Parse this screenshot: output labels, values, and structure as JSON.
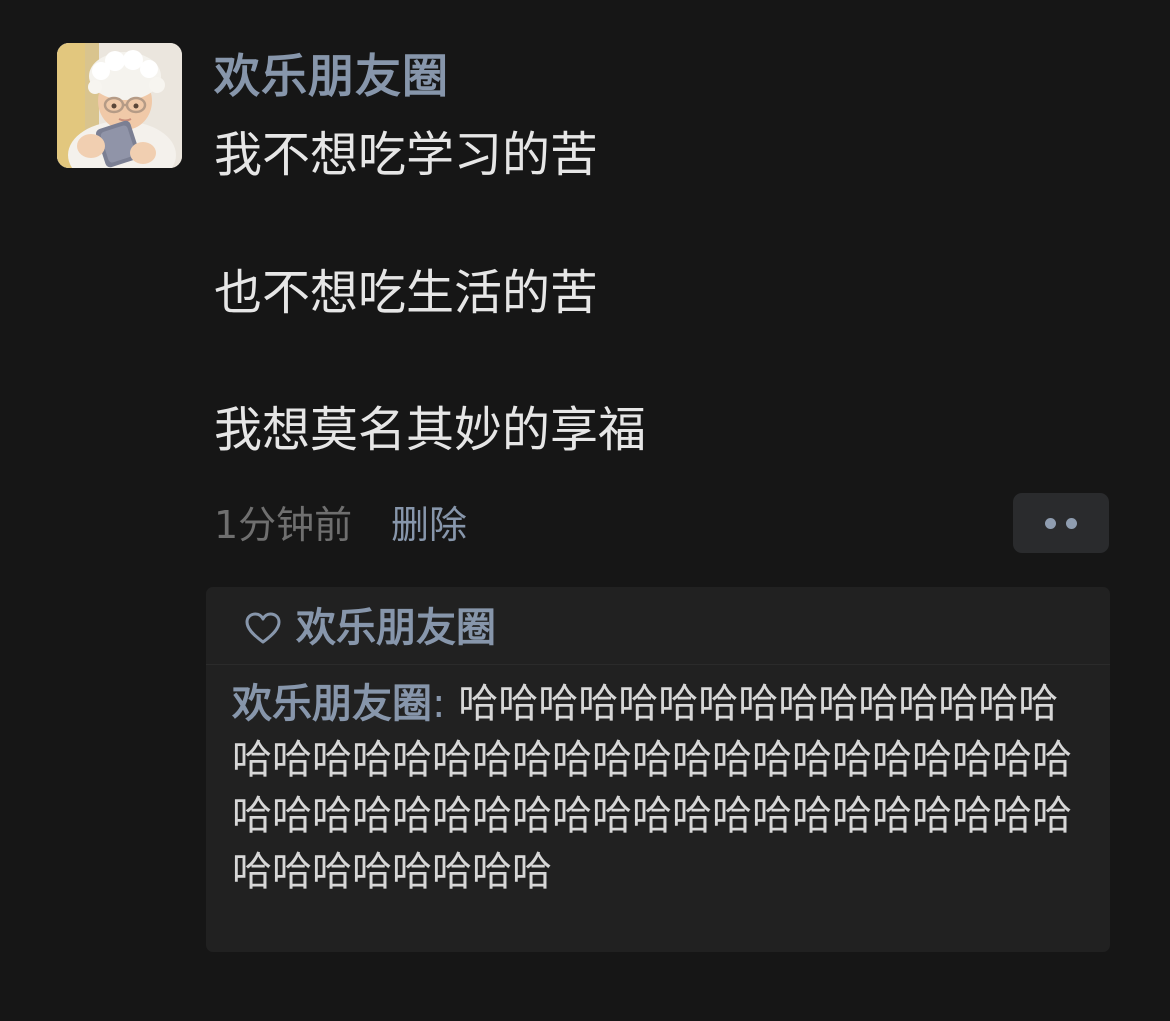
{
  "post": {
    "username": "欢乐朋友圈",
    "lines": [
      "我不想吃学习的苦",
      "也不想吃生活的苦",
      "我想莫名其妙的享福"
    ],
    "time": "1分钟前",
    "delete_label": "删除"
  },
  "interactions": {
    "likes": [
      {
        "name": "欢乐朋友圈"
      }
    ],
    "comments": [
      {
        "author": "欢乐朋友圈",
        "separator": ":",
        "text": "哈哈哈哈哈哈哈哈哈哈哈哈哈哈哈哈哈哈哈哈哈哈哈哈哈哈哈哈哈哈哈哈哈哈哈哈哈哈哈哈哈哈哈哈哈哈哈哈哈哈哈哈哈哈哈哈哈哈哈哈哈哈哈哈哈"
      }
    ]
  },
  "icons": {
    "like": "heart-outline-icon",
    "more": "more-dots-icon"
  },
  "colors": {
    "background": "#161616",
    "panel": "#212121",
    "name_accent": "#8796ab",
    "body_text": "#e6e6e6",
    "muted_text": "#6f6f6f",
    "more_button": "#2a2b2d"
  }
}
